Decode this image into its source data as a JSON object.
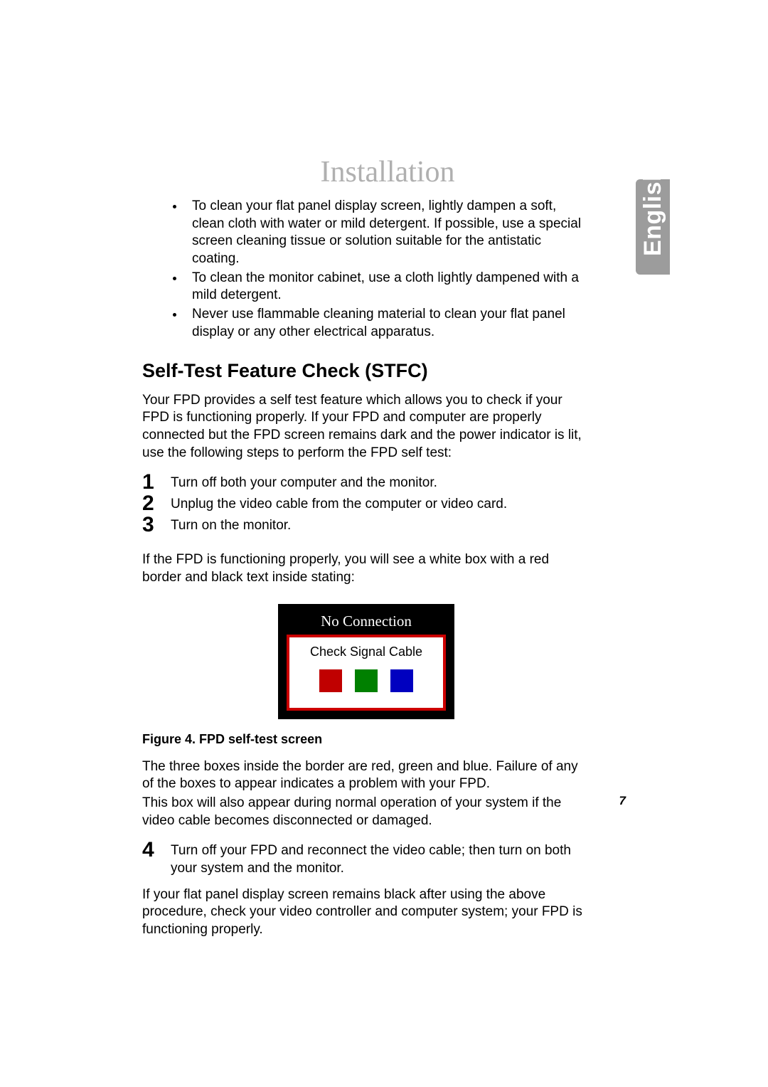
{
  "header": {
    "title": "Installation",
    "language_tab": "English"
  },
  "bullets": [
    "To clean your flat panel display screen, lightly dampen a soft, clean cloth with water or mild detergent. If possible, use a special screen cleaning tissue or solution suitable for the antistatic coating.",
    "To clean the monitor cabinet, use a cloth lightly dampened with a mild detergent.",
    "Never use flammable cleaning material to clean your flat panel display or any other electrical apparatus."
  ],
  "section_heading": "Self-Test Feature Check (STFC)",
  "intro": "Your FPD provides a self test feature which allows you to check if your FPD is functioning properly. If your FPD and computer are properly connected but the FPD screen remains dark and the power indicator is lit, use the following steps to perform the FPD self test:",
  "steps_a": [
    {
      "num": "1",
      "text": "Turn off both your computer and the monitor."
    },
    {
      "num": "2",
      "text": "Unplug the video cable from the computer or video card."
    },
    {
      "num": "3",
      "text": "Turn on the monitor."
    }
  ],
  "after_steps": "If the FPD is functioning properly, you will see a white box with a red border and black text inside stating:",
  "figure": {
    "title": "No Connection",
    "subtitle": "Check Signal Cable",
    "caption": "Figure 4.  FPD self-test screen"
  },
  "para_after_fig_1": "The three boxes inside the border are red, green and blue. Failure of any of the boxes to appear indicates a problem with your FPD.",
  "para_after_fig_2": "This box will also appear during normal operation of your system if the video cable becomes disconnected or damaged.",
  "steps_b": [
    {
      "num": "4",
      "text": "Turn off your FPD and reconnect the video cable; then turn on both your system and the monitor."
    }
  ],
  "closing": "If your flat panel display screen remains black after using the above procedure, check your video controller and computer system; your FPD is functioning properly.",
  "page_number": "7"
}
